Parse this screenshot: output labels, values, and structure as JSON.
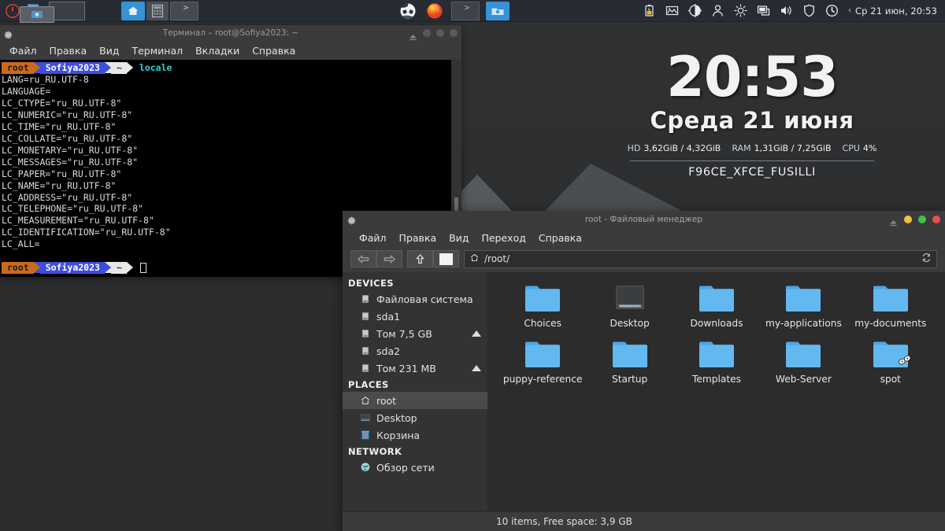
{
  "panel": {
    "launchers": [
      {
        "name": "power-icon",
        "label": "Power"
      },
      {
        "name": "trash-icon",
        "label": "Корзина"
      },
      {
        "name": "window-icon",
        "label": "Окно"
      },
      {
        "name": "home-icon",
        "label": "Домашняя папка"
      },
      {
        "name": "calculator-icon",
        "label": "Калькулятор"
      },
      {
        "name": "terminal-icon",
        "label": "Терминал"
      }
    ],
    "tasks": [
      {
        "name": "task-pmusic",
        "label": "PMusic"
      },
      {
        "name": "task-firefox",
        "label": "Firefox"
      },
      {
        "name": "task-terminal",
        "label": "Терминал"
      },
      {
        "name": "task-filemanager",
        "label": "Файловый менеджер"
      }
    ],
    "tray": [
      {
        "name": "battery-icon",
        "label": "Батарея"
      },
      {
        "name": "image-icon",
        "label": "Изображение"
      },
      {
        "name": "contrast-icon",
        "label": "Контраст"
      },
      {
        "name": "user-icon",
        "label": "Пользователь"
      },
      {
        "name": "brightness-icon",
        "label": "Яркость"
      },
      {
        "name": "display-icon",
        "label": "Дисплей"
      },
      {
        "name": "volume-icon",
        "label": "Громкость"
      },
      {
        "name": "shield-icon",
        "label": "Защита"
      },
      {
        "name": "clock-icon",
        "label": "Часы"
      }
    ],
    "clock": "Ср 21 июн, 20:53",
    "clock_chevron": "‹"
  },
  "terminal": {
    "title": "Терминал – root@Sofiya2023: ~",
    "menu": [
      "Файл",
      "Правка",
      "Вид",
      "Терминал",
      "Вкладки",
      "Справка"
    ],
    "prompt": {
      "user": "root",
      "host": "Sofiya2023",
      "path": "~"
    },
    "command": "locale",
    "output": [
      "LANG=ru_RU.UTF-8",
      "LANGUAGE=",
      "LC_CTYPE=\"ru_RU.UTF-8\"",
      "LC_NUMERIC=\"ru_RU.UTF-8\"",
      "LC_TIME=\"ru_RU.UTF-8\"",
      "LC_COLLATE=\"ru_RU.UTF-8\"",
      "LC_MONETARY=\"ru_RU.UTF-8\"",
      "LC_MESSAGES=\"ru_RU.UTF-8\"",
      "LC_PAPER=\"ru_RU.UTF-8\"",
      "LC_NAME=\"ru_RU.UTF-8\"",
      "LC_ADDRESS=\"ru_RU.UTF-8\"",
      "LC_TELEPHONE=\"ru_RU.UTF-8\"",
      "LC_MEASUREMENT=\"ru_RU.UTF-8\"",
      "LC_IDENTIFICATION=\"ru_RU.UTF-8\"",
      "LC_ALL="
    ]
  },
  "conky": {
    "time": "20:53",
    "date": "Среда 21 июня",
    "hd_label": "HD",
    "hd_value": "3,62GiB / 4,32GiB",
    "ram_label": "RAM",
    "ram_value": "1,31GiB / 7,25GiB",
    "cpu_label": "CPU",
    "cpu_value": "4%",
    "hostname": "F96CE_XFCE_FUSILLI"
  },
  "filemanager": {
    "title": "root - Файловый менеджер",
    "menu": [
      "Файл",
      "Правка",
      "Вид",
      "Переход",
      "Справка"
    ],
    "toolbar": {
      "back": "Назад",
      "forward": "Вперёд",
      "up": "Вверх",
      "home": "Домой",
      "reload": "Обновить"
    },
    "path": "/root/",
    "sidebar": [
      {
        "group": "DEVICES",
        "items": [
          {
            "label": "Файловая система",
            "icon": "drive-icon",
            "eject": false,
            "selected": false
          },
          {
            "label": "sda1",
            "icon": "drive-icon",
            "eject": false,
            "selected": false
          },
          {
            "label": "Том 7,5 GB",
            "icon": "drive-icon",
            "eject": true,
            "selected": false
          },
          {
            "label": "sda2",
            "icon": "drive-icon",
            "eject": false,
            "selected": false
          },
          {
            "label": "Том 231 MB",
            "icon": "drive-icon",
            "eject": true,
            "selected": false
          }
        ]
      },
      {
        "group": "PLACES",
        "items": [
          {
            "label": "root",
            "icon": "home-icon",
            "eject": false,
            "selected": true
          },
          {
            "label": "Desktop",
            "icon": "desktop-icon",
            "eject": false,
            "selected": false
          },
          {
            "label": "Корзина",
            "icon": "trash-icon",
            "eject": false,
            "selected": false
          }
        ]
      },
      {
        "group": "NETWORK",
        "items": [
          {
            "label": "Обзор сети",
            "icon": "network-icon",
            "eject": false,
            "selected": false
          }
        ]
      }
    ],
    "files": [
      {
        "label": "Choices",
        "type": "folder"
      },
      {
        "label": "Desktop",
        "type": "desktop-folder"
      },
      {
        "label": "Downloads",
        "type": "folder"
      },
      {
        "label": "my-applications",
        "type": "folder"
      },
      {
        "label": "my-documents",
        "type": "folder"
      },
      {
        "label": "puppy-reference",
        "type": "folder"
      },
      {
        "label": "Startup",
        "type": "folder"
      },
      {
        "label": "Templates",
        "type": "folder"
      },
      {
        "label": "Web-Server",
        "type": "folder"
      },
      {
        "label": "spot",
        "type": "folder-link"
      }
    ],
    "status": "10 items, Free space: 3,9 GB"
  },
  "colors": {
    "panel_bg": "#272b33",
    "window_bg": "#3b3b3b",
    "folder_blue": "#49a6e8",
    "prompt_orange": "#cd6a1c",
    "prompt_blue": "#3d4edb",
    "terminal_cyan": "#2ad4d4",
    "close_red": "#ef4b4b",
    "max_green": "#3fc34a",
    "min_yellow": "#f0c040"
  }
}
